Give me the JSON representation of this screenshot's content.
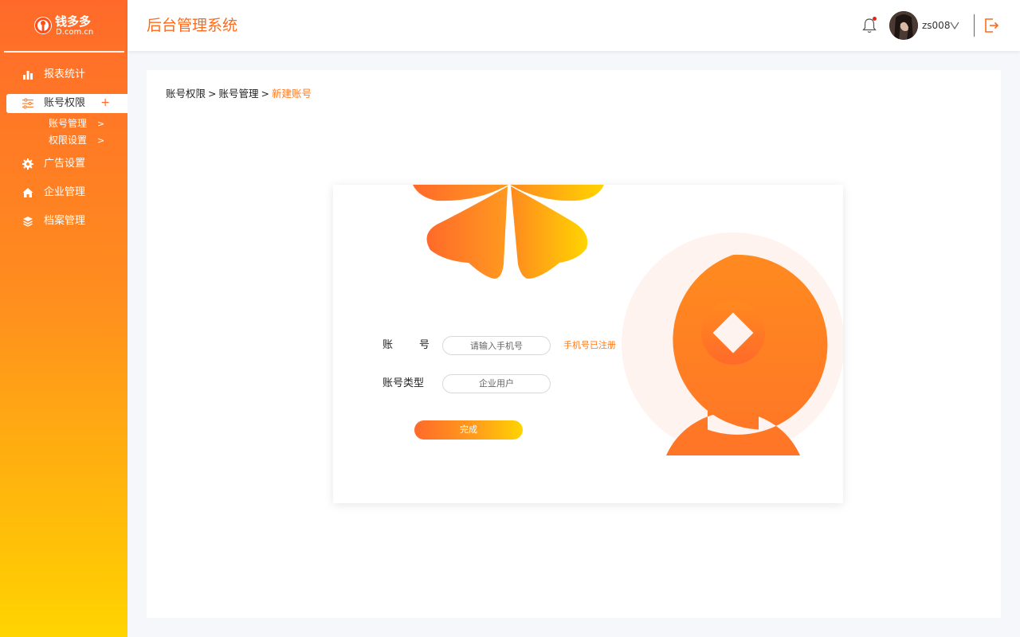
{
  "brand": {
    "name_cn": "钱多多",
    "domain": "D.com.cn"
  },
  "sidebar": {
    "items": [
      {
        "label": "报表统计",
        "icon": "bar-chart-icon"
      },
      {
        "label": "账号权限",
        "icon": "sliders-icon",
        "active": true,
        "expand_symbol": "+"
      },
      {
        "label": "广告设置",
        "icon": "gear-icon"
      },
      {
        "label": "企业管理",
        "icon": "home-icon"
      },
      {
        "label": "档案管理",
        "icon": "layers-icon"
      }
    ],
    "sub_items": [
      {
        "label": "账号管理",
        "arrow": ">"
      },
      {
        "label": "权限设置",
        "arrow": ">"
      }
    ]
  },
  "header": {
    "title": "后台管理系统",
    "username": "zs008"
  },
  "breadcrumb": {
    "items": [
      "账号权限",
      "账号管理"
    ],
    "separator": ">",
    "current": "新建账号"
  },
  "form": {
    "account_label": "账        号",
    "account_placeholder": "请输入手机号",
    "account_hint": "手机号已注册",
    "type_label": "账号类型",
    "type_value": "企业用户",
    "submit_label": "完成"
  },
  "colors": {
    "accent": "#ff6a1a",
    "gradient_start": "#ff6a2a",
    "gradient_end": "#ffd400"
  }
}
